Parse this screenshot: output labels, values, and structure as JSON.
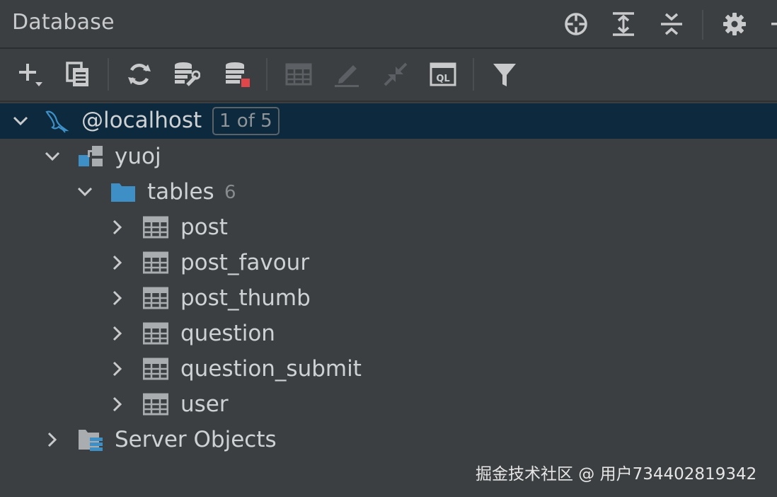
{
  "header": {
    "title": "Database"
  },
  "toolbar": {
    "icons": [
      "add-icon",
      "duplicate-icon",
      "refresh-icon",
      "data-source-properties-icon",
      "stop-icon",
      "table-editor-icon",
      "edit-icon",
      "jump-to-source-icon",
      "query-console-icon",
      "filter-icon"
    ]
  },
  "tree": {
    "host": {
      "label": "@localhost",
      "badge": "1 of 5"
    },
    "schema": {
      "label": "yuoj"
    },
    "tables_folder": {
      "label": "tables",
      "count": "6"
    },
    "tables": [
      {
        "label": "post"
      },
      {
        "label": "post_favour"
      },
      {
        "label": "post_thumb"
      },
      {
        "label": "question"
      },
      {
        "label": "question_submit"
      },
      {
        "label": "user"
      }
    ],
    "server_objects": {
      "label": "Server Objects"
    }
  },
  "watermark": "掘金技术社区 @ 用户734402819342",
  "colors": {
    "background": "#3c3f41",
    "selection": "#0d293e",
    "icon_gray": "#a9adb0",
    "icon_blue": "#3d8fc6",
    "stop_red": "#e0464a"
  }
}
